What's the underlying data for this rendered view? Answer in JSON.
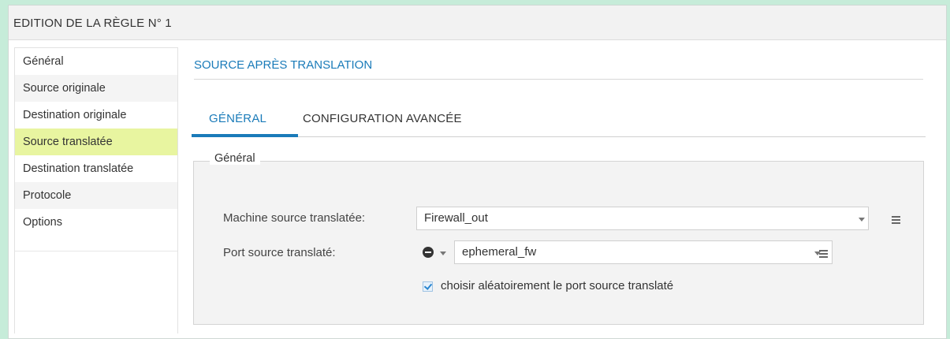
{
  "dialog": {
    "title": "EDITION DE LA RÈGLE N° 1"
  },
  "sidebar": {
    "items": [
      {
        "label": "Général"
      },
      {
        "label": "Source originale"
      },
      {
        "label": "Destination originale"
      },
      {
        "label": "Source translatée"
      },
      {
        "label": "Destination translatée"
      },
      {
        "label": "Protocole"
      },
      {
        "label": "Options"
      }
    ],
    "active_label": "Source translatée"
  },
  "section": {
    "title": "SOURCE APRÈS TRANSLATION"
  },
  "tabs": [
    {
      "label": "GÉNÉRAL"
    },
    {
      "label": "CONFIGURATION AVANCÉE"
    }
  ],
  "active_tab": "GÉNÉRAL",
  "fieldset": {
    "legend": "Général",
    "machine_label": "Machine source translatée:",
    "machine_value": "Firewall_out",
    "port_label": "Port source translaté:",
    "port_value": "ephemeral_fw",
    "random_port_label": "choisir aléatoirement le port source translaté",
    "random_port_checked": true
  },
  "colors": {
    "accent": "#1a7bb9",
    "active_item": "#e8f5a0",
    "frame": "#c6ecd9"
  }
}
